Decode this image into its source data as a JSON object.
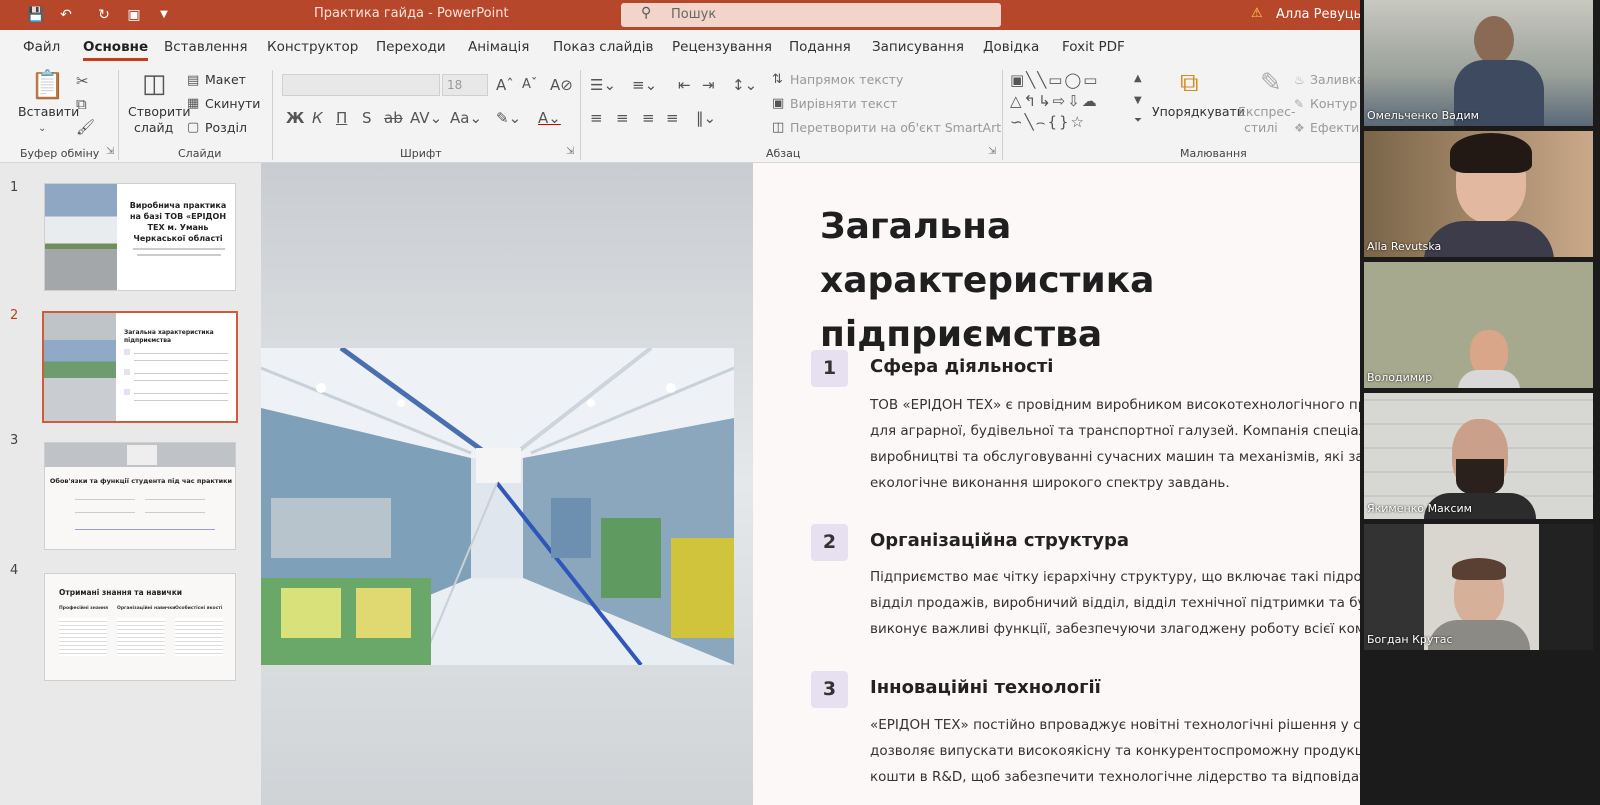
{
  "titlebar": {
    "doc_title": "Практика гайда  -  PowerPoint",
    "search_placeholder": "Пошук",
    "user_name": "Алла Ревуцька"
  },
  "menu": {
    "tabs": [
      "Файл",
      "Основне",
      "Вставлення",
      "Конструктор",
      "Переходи",
      "Анімація",
      "Показ слайдів",
      "Рецензування",
      "Подання",
      "Записування",
      "Довідка",
      "Foxit PDF"
    ],
    "active_tab": "Основне"
  },
  "ribbon": {
    "clipboard": {
      "paste_label": "Вставити",
      "group_label": "Буфер обміну"
    },
    "slides": {
      "new_slide_line1": "Створити",
      "new_slide_line2": "слайд",
      "layout": "Макет",
      "reset": "Скинути",
      "section": "Розділ",
      "group_label": "Слайди"
    },
    "font": {
      "font_size": "18",
      "bold": "Ж",
      "italic": "К",
      "underline": "П",
      "strike": "S",
      "group_label": "Шрифт"
    },
    "paragraph": {
      "text_direction": "Напрямок тексту",
      "align_text": "Вирівняти текст",
      "smartart": "Перетворити на об'єкт SmartArt",
      "group_label": "Абзац"
    },
    "drawing": {
      "arrange": "Упорядкувати",
      "quick_styles_line1": "Експрес-",
      "quick_styles_line2": "стилі",
      "fill": "Заливка",
      "outline": "Контур",
      "effects": "Ефекти",
      "group_label": "Малювання"
    }
  },
  "thumbnails": [
    {
      "num": "1",
      "title": "Виробнича практика на базі ТОВ «ЕРІДОН ТЕХ м. Умань Черкаської області"
    },
    {
      "num": "2",
      "title": "Загальна характеристика підприємства",
      "selected": true
    },
    {
      "num": "3",
      "title": "Обов'язки та функції студента під час практики"
    },
    {
      "num": "4",
      "title": "Отримані знання та навички",
      "cols": [
        "Професійні знання",
        "Організаційні навички",
        "Особистісні якості"
      ]
    }
  ],
  "slide": {
    "title": "Загальна характеристика підприємства",
    "sections": [
      {
        "num": "1",
        "heading": "Сфера діяльності",
        "lines": [
          "ТОВ «ЕРІДОН ТЕХ» є провідним виробником високотехнологічного пром",
          "для аграрної, будівельної та транспортної галузей. Компанія спеціалізує",
          "виробництві та обслуговуванні сучасних машин та механізмів, які забез",
          "екологічне виконання широкого спектру завдань."
        ]
      },
      {
        "num": "2",
        "heading": "Організаційна структура",
        "lines": [
          "Підприємство має чітку ієрархічну структуру, що включає такі підрозділ",
          "відділ продажів, виробничий відділ, відділ технічної підтримки та бухга",
          "виконує важливі функції, забезпечуючи злагоджену роботу всієї компан"
        ]
      },
      {
        "num": "3",
        "heading": "Інноваційні технології",
        "lines": [
          "«ЕРІДОН ТЕХ» постійно впроваджує новітні технологічні рішення у своє виробництво, що",
          "дозволяє випускати високоякісну та конкурентоспроможну продукцію. Компанія інвестує значні",
          "кошти в R&D, щоб забезпечити технологічне лідерство та відповідати сучасним вимогам ринку."
        ]
      }
    ]
  },
  "participants": [
    {
      "name": "Омельченко Вадим"
    },
    {
      "name": "Alla Revutska"
    },
    {
      "name": "Володимир"
    },
    {
      "name": "Якименко Максим"
    },
    {
      "name": "Богдан Крутас"
    }
  ],
  "colors": {
    "accent": "#b7472a",
    "tab_underline": "#c43e1c",
    "number_box": "#e6e0f0"
  }
}
